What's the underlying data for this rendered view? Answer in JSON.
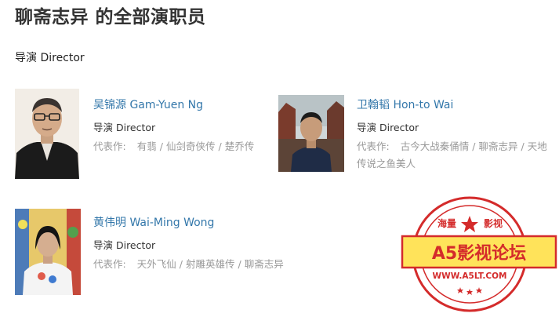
{
  "page": {
    "title": "聊斋志异 的全部演职员"
  },
  "section": {
    "label": "导演 Director"
  },
  "people": [
    {
      "name": "吴锦源 Gam-Yuen Ng",
      "role": "导演 Director",
      "works_label": "代表作:",
      "works": [
        "有翡",
        "仙剑奇侠传",
        "楚乔传"
      ]
    },
    {
      "name": "卫翰韬 Hon-to Wai",
      "role": "导演 Director",
      "works_label": "代表作:",
      "works": [
        "古今大战秦俑情",
        "聊斋志异",
        "天地传说之鱼美人"
      ]
    },
    {
      "name": "黄伟明 Wai-Ming Wong",
      "role": "导演 Director",
      "works_label": "代表作:",
      "works": [
        "天外飞仙",
        "射雕英雄传",
        "聊斋志异"
      ]
    }
  ],
  "watermark": {
    "top_left": "海量",
    "top_right": "影视",
    "banner": "A5影视论坛",
    "url": "WWW.A5LT.COM",
    "colors": {
      "ring": "#d42b2b",
      "banner_bg": "#ffe35a"
    }
  }
}
